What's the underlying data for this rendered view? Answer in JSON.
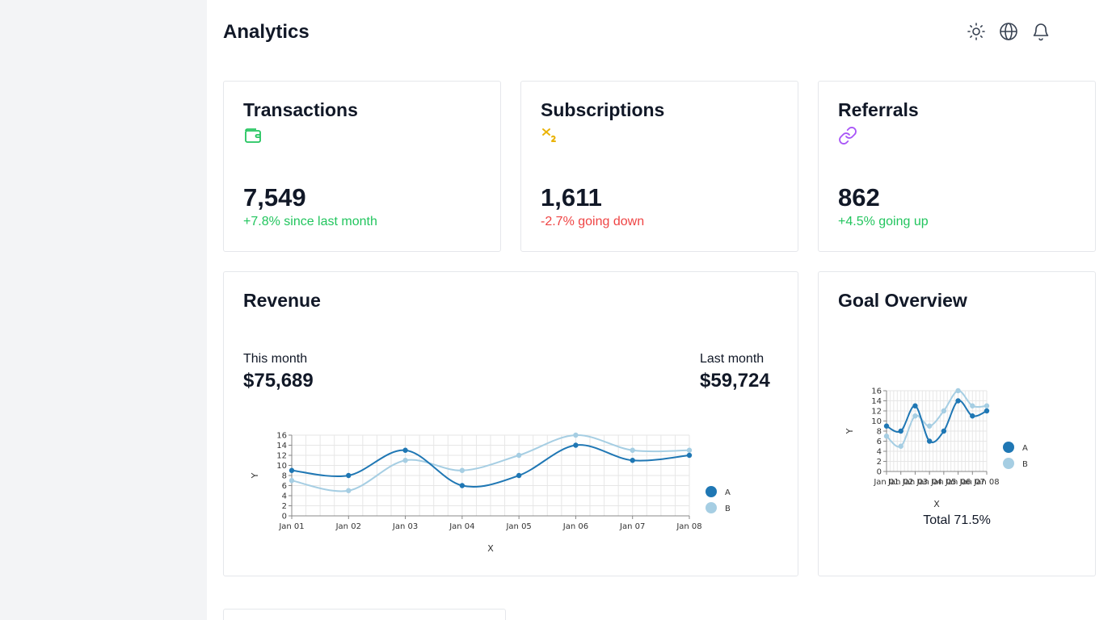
{
  "header": {
    "title": "Analytics",
    "icons": [
      "sun-icon",
      "globe-icon",
      "bell-icon"
    ]
  },
  "stats": [
    {
      "title": "Transactions",
      "icon": "wallet-icon",
      "value": "7,549",
      "delta": "+7.8% since last month",
      "trend": "up"
    },
    {
      "title": "Subscriptions",
      "icon": "subscript-icon",
      "value": "1,611",
      "delta": "-2.7% going down",
      "trend": "down"
    },
    {
      "title": "Referrals",
      "icon": "link-icon",
      "value": "862",
      "delta": "+4.5% going up",
      "trend": "up"
    }
  ],
  "revenue": {
    "title": "Revenue",
    "this_month_label": "This month",
    "this_month_value": "$75,689",
    "last_month_label": "Last month",
    "last_month_value": "$59,724"
  },
  "goal": {
    "title": "Goal Overview",
    "total": "Total 71.5%"
  },
  "colors": {
    "series_a": "#1f77b4",
    "series_b": "#a6cee3",
    "wallet": "#22c55e",
    "subscript": "#eab308",
    "link": "#a855f7",
    "up": "#22c55e",
    "down": "#ef4444"
  },
  "chart_data": [
    {
      "type": "line",
      "xlabel": "X",
      "ylabel": "Y",
      "categories": [
        "Jan 01",
        "Jan 02",
        "Jan 03",
        "Jan 04",
        "Jan 05",
        "Jan 06",
        "Jan 07",
        "Jan 08"
      ],
      "yticks": [
        "0",
        "2",
        "4",
        "6",
        "8",
        "10",
        "12",
        "14",
        "16"
      ],
      "ylim": [
        0,
        16
      ],
      "grid": true,
      "legend": "right",
      "series": [
        {
          "name": "A",
          "values": [
            9,
            8,
            13,
            6,
            8,
            14,
            11,
            12
          ]
        },
        {
          "name": "B",
          "values": [
            7,
            5,
            11,
            9,
            12,
            16,
            13,
            13
          ]
        }
      ]
    },
    {
      "type": "line",
      "xlabel": "X",
      "ylabel": "Y",
      "categories": [
        "Jan 01",
        "Jan 02",
        "Jan 03",
        "Jan 04",
        "Jan 05",
        "Jan 06",
        "Jan 07",
        "Jan 08"
      ],
      "yticks": [
        "0",
        "2",
        "4",
        "6",
        "8",
        "10",
        "12",
        "14",
        "16"
      ],
      "ylim": [
        0,
        16
      ],
      "grid": true,
      "legend": "right",
      "series": [
        {
          "name": "A",
          "values": [
            9,
            8,
            13,
            6,
            8,
            14,
            11,
            12
          ]
        },
        {
          "name": "B",
          "values": [
            7,
            5,
            11,
            9,
            12,
            16,
            13,
            13
          ]
        }
      ]
    }
  ]
}
